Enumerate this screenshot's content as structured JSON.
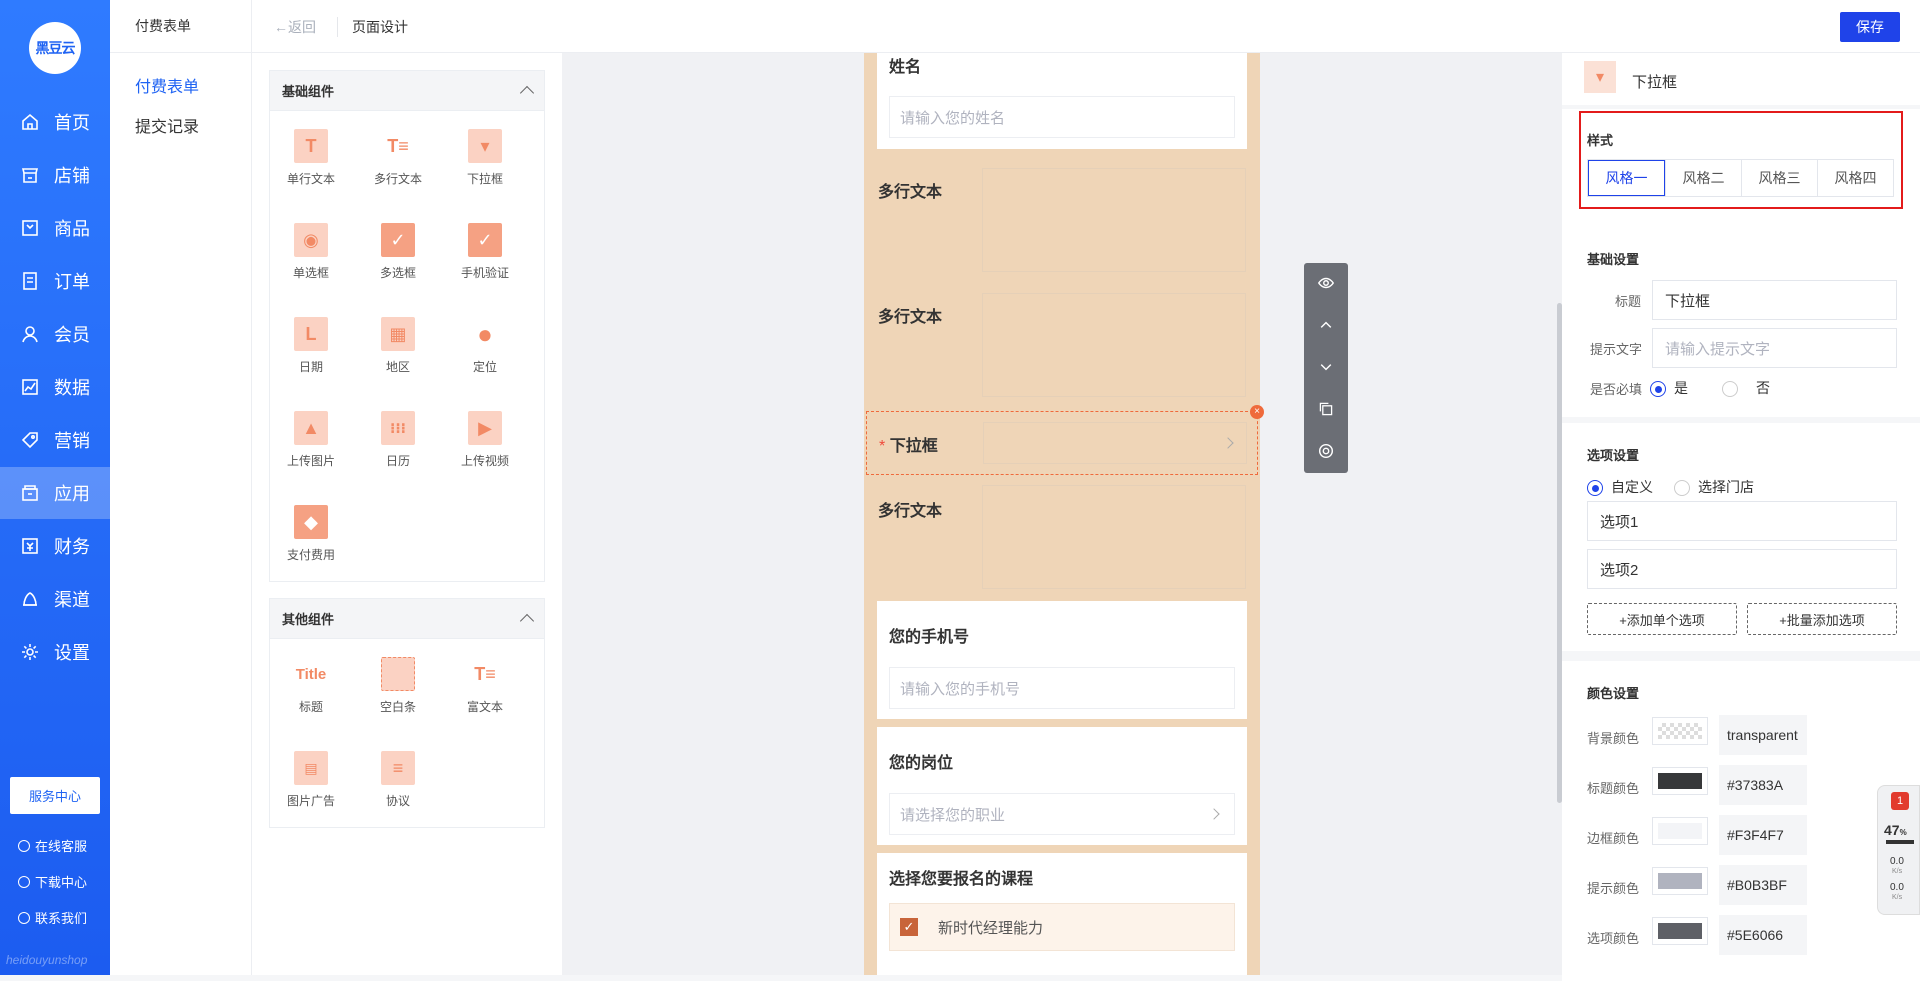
{
  "nav": {
    "logo": "黑豆云",
    "items": [
      "首页",
      "店铺",
      "商品",
      "订单",
      "会员",
      "数据",
      "营销",
      "应用",
      "财务",
      "渠道",
      "设置"
    ],
    "service_center": "服务中心",
    "online_service": "在线客服",
    "download_center": "下载中心",
    "contact_us": "联系我们",
    "watermark": "heidouyunshop"
  },
  "sub": {
    "title": "付费表单",
    "items": [
      "付费表单",
      "提交记录"
    ]
  },
  "topbar": {
    "back": "←返回",
    "title": "页面设计",
    "save": "保存"
  },
  "basic": {
    "title": "基础组件",
    "items": [
      "单行文本",
      "多行文本",
      "下拉框",
      "单选框",
      "多选框",
      "手机验证",
      "日期",
      "地区",
      "定位",
      "上传图片",
      "日历",
      "上传视频",
      "支付费用"
    ]
  },
  "other": {
    "title": "其他组件",
    "items": [
      "标题",
      "空白条",
      "富文本",
      "图片广告",
      "协议"
    ],
    "title_icon_text": "Title"
  },
  "form": {
    "name_label": "姓名",
    "name_placeholder": "请输入您的姓名",
    "multiline": "多行文本",
    "select_label": "下拉框",
    "required_mark": "*",
    "phone_label": "您的手机号",
    "phone_placeholder": "请输入您的手机号",
    "job_label": "您的岗位",
    "job_placeholder": "请选择您的职业",
    "course_label": "选择您要报名的课程",
    "course_option": "新时代经理能力",
    "close": "×"
  },
  "props": {
    "header": "下拉框",
    "style_title": "样式",
    "styles": [
      "风格一",
      "风格二",
      "风格三",
      "风格四"
    ],
    "basic_title": "基础设置",
    "title_label": "标题",
    "title_value": "下拉框",
    "hint_label": "提示文字",
    "hint_placeholder": "请输入提示文字",
    "required_label": "是否必填",
    "yes": "是",
    "no": "否",
    "options_title": "选项设置",
    "custom": "自定义",
    "store": "选择门店",
    "options": [
      "选项1",
      "选项2"
    ],
    "add_single": "+添加单个选项",
    "add_batch": "+批量添加选项",
    "color_title": "颜色设置",
    "colors": [
      {
        "label": "背景颜色",
        "value": "transparent",
        "swatch": "transparent"
      },
      {
        "label": "标题颜色",
        "value": "#37383A",
        "swatch": "#37383A"
      },
      {
        "label": "边框颜色",
        "value": "#F3F4F7",
        "swatch": "#F3F4F7"
      },
      {
        "label": "提示颜色",
        "value": "#B0B3BF",
        "swatch": "#B0B3BF"
      },
      {
        "label": "选项颜色",
        "value": "#5E6066",
        "swatch": "#5E6066"
      }
    ]
  },
  "widget": {
    "badge": "1",
    "percent": "47",
    "percent_unit": "%",
    "up": "0.0",
    "down": "0.0",
    "unit": "K/s"
  }
}
